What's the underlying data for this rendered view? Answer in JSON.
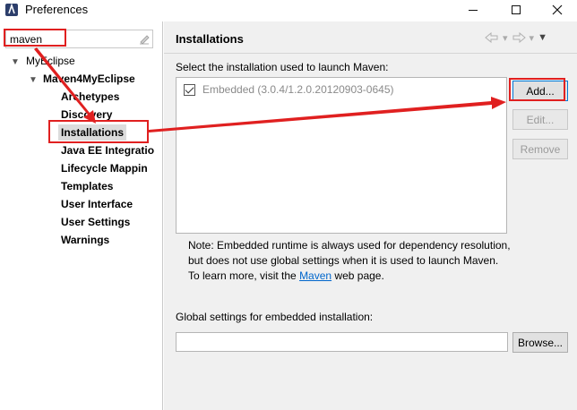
{
  "window": {
    "title": "Preferences"
  },
  "filter": {
    "value": "maven"
  },
  "tree": {
    "root": "MyEclipse",
    "group": "Maven4MyEclipse",
    "items": [
      "Archetypes",
      "Discovery",
      "Installations",
      "Java EE Integratio",
      "Lifecycle Mappin",
      "Templates",
      "User Interface",
      "User Settings",
      "Warnings"
    ]
  },
  "main": {
    "title": "Installations",
    "select_label": "Select the installation used to launch Maven:",
    "installations": [
      {
        "label": "Embedded (3.0.4/1.2.0.20120903-0645)",
        "checked": true
      }
    ],
    "buttons": {
      "add": "Add...",
      "edit": "Edit...",
      "remove": "Remove",
      "browse": "Browse..."
    },
    "note_before_link": "Note: Embedded runtime is always used for dependency resolution, but does not use global settings when it is used to launch Maven. To learn more, visit the ",
    "note_link": "Maven",
    "note_after_link": " web page.",
    "global_label": "Global settings for embedded installation:",
    "global_value": ""
  },
  "colors": {
    "annotation": "#e02020",
    "link": "#0066cc",
    "selection": "#dcdcdc"
  },
  "icons": [
    "app-icon",
    "clear-icon",
    "expand-arrow-icon",
    "back-arrow-icon",
    "forward-arrow-icon",
    "view-menu-icon"
  ]
}
